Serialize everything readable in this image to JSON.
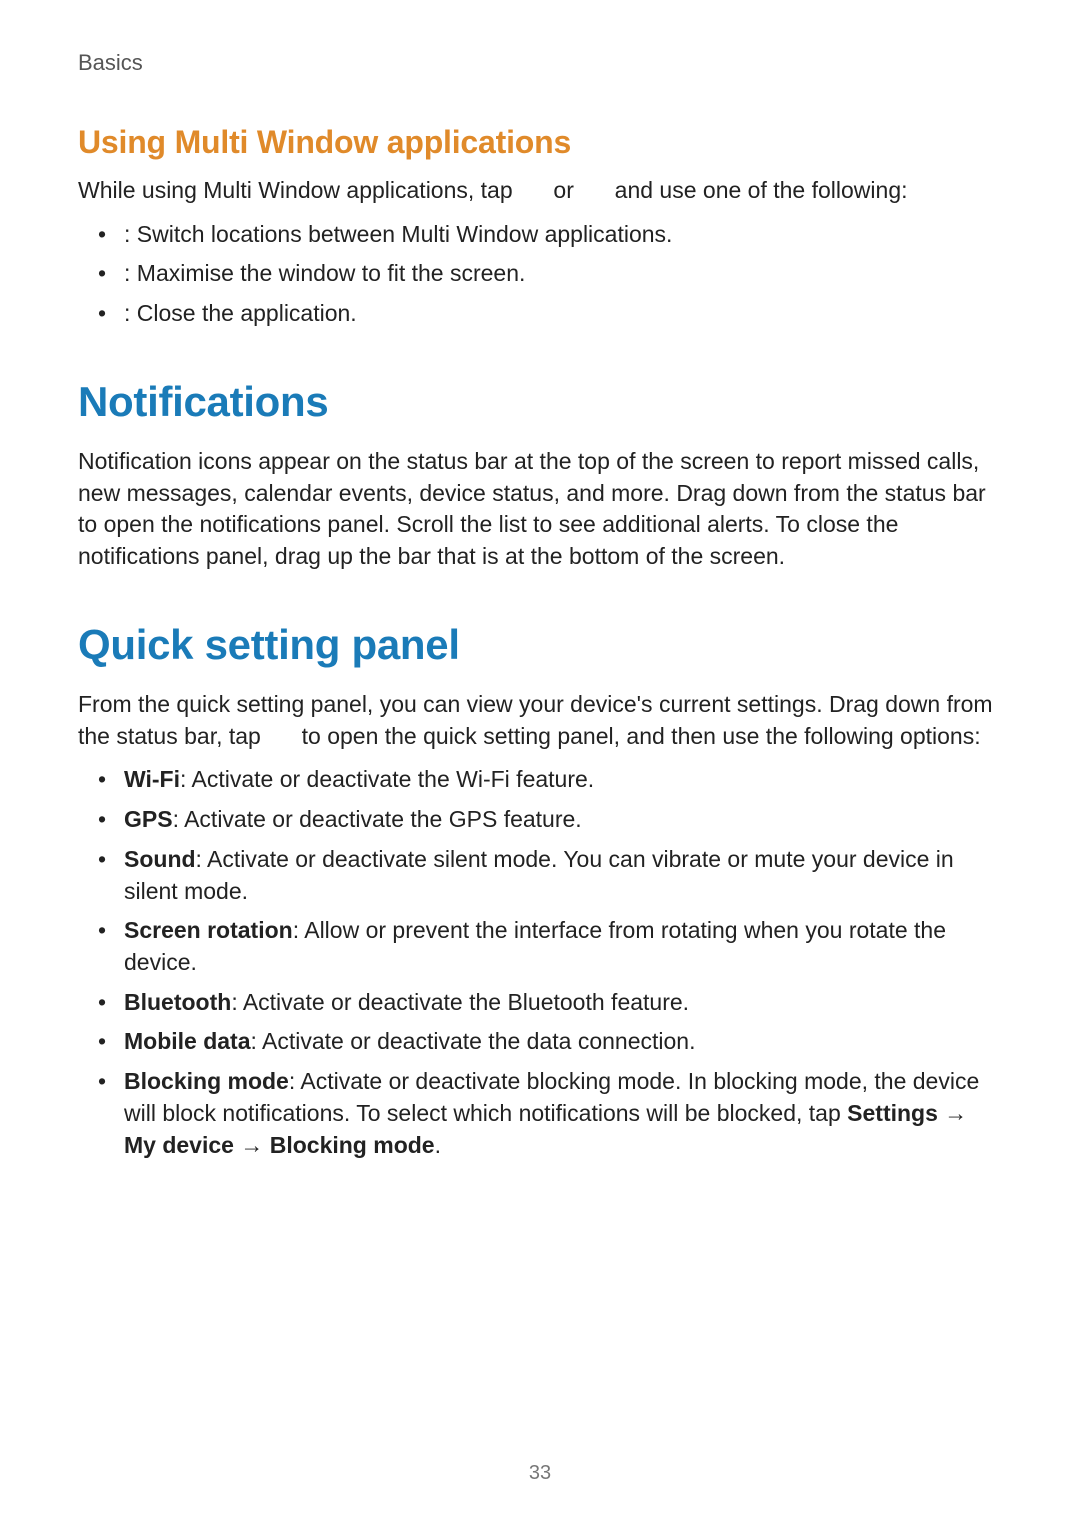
{
  "breadcrumb": "Basics",
  "page_number": "33",
  "multiwindow": {
    "heading": "Using Multi Window applications",
    "intro_1": "While using Multi Window applications, tap ",
    "intro_or": " or ",
    "intro_2": " and use one of the following:",
    "items": [
      " : Switch locations between Multi Window applications.",
      "  : Maximise the window to fit the screen.",
      " : Close the application."
    ]
  },
  "notifications": {
    "heading": "Notifications",
    "body": "Notification icons appear on the status bar at the top of the screen to report missed calls, new messages, calendar events, device status, and more. Drag down from the status bar to open the notifications panel. Scroll the list to see additional alerts. To close the notifications panel, drag up the bar that is at the bottom of the screen."
  },
  "quickpanel": {
    "heading": "Quick setting panel",
    "intro_1": "From the quick setting panel, you can view your device's current settings. Drag down from the status bar, tap ",
    "intro_2": " to open the quick setting panel, and then use the following options:",
    "items": [
      {
        "bold": "Wi-Fi",
        "rest": ": Activate or deactivate the Wi-Fi feature."
      },
      {
        "bold": "GPS",
        "rest": ": Activate or deactivate the GPS feature."
      },
      {
        "bold": "Sound",
        "rest": ": Activate or deactivate silent mode. You can vibrate or mute your device in silent mode."
      },
      {
        "bold": "Screen rotation",
        "rest": ": Allow or prevent the interface from rotating when you rotate the device."
      },
      {
        "bold": "Bluetooth",
        "rest": ": Activate or deactivate the Bluetooth feature."
      },
      {
        "bold": "Mobile data",
        "rest": ": Activate or deactivate the data connection."
      }
    ],
    "blocking": {
      "bold1": "Blocking mode",
      "text1": ": Activate or deactivate blocking mode. In blocking mode, the device will block notifications. To select which notifications will be blocked, tap ",
      "bold2": "Settings",
      "arrow1": " → ",
      "bold3": "My device",
      "arrow2": " → ",
      "bold4": "Blocking mode",
      "end": "."
    }
  }
}
